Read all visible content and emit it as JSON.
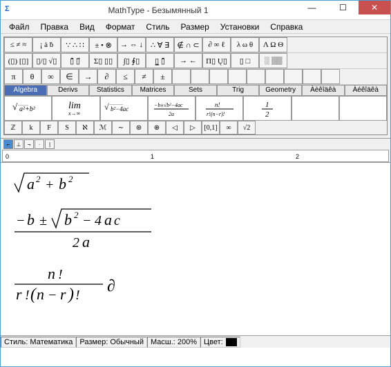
{
  "window": {
    "title": "MathType - Безымянный 1",
    "icon": "Σ"
  },
  "menu": [
    "Файл",
    "Правка",
    "Вид",
    "Формат",
    "Стиль",
    "Размер",
    "Установки",
    "Справка"
  ],
  "palette_row1": [
    "≤ ≠ ≈",
    "¡ ȧ ḃ",
    "∵ ∴ ∷",
    "± • ⊗",
    "→ ⇔ ↓",
    "∴ ∀ ∃",
    "∉ ∩ ⊂",
    "∂ ∞ ℓ",
    "λ ω θ",
    "Λ Ω Θ"
  ],
  "palette_row2": [
    "(▯) [▯]",
    "▯/▯ √▯",
    "▯̄ ▯⃗",
    "Σ▯ ▯▯",
    "∫▯ ∮▯",
    "▯̲ ▯̄",
    "→ ←",
    "Π▯ Ų▯",
    "▯ □",
    "░ ▒▒"
  ],
  "palette_row3": [
    "π",
    "θ",
    "∞",
    "∈",
    "→",
    "∂",
    "≤",
    "≠",
    "±",
    "",
    "",
    "",
    "",
    "",
    "",
    "",
    "",
    ""
  ],
  "tabs": [
    "Algebra",
    "Derivs",
    "Statistics",
    "Matrices",
    "Sets",
    "Trig",
    "Geometry",
    "Àèêîäêà",
    "Àéêîäêà"
  ],
  "active_tab": 0,
  "small_row": [
    "ℤ",
    "k",
    "F",
    "S",
    "ℵ",
    "ℳ",
    "∼",
    "⊛",
    "⊕",
    "◁",
    "▷",
    "[0,1]",
    "∞",
    "√2"
  ],
  "status": {
    "style_label": "Стиль:",
    "style_value": "Математика",
    "size_label": "Размер:",
    "size_value": "Обычный",
    "zoom_label": "Масш.:",
    "zoom_value": "200%",
    "color_label": "Цвет:"
  },
  "ruler_nums": [
    "0",
    "1",
    "2"
  ]
}
